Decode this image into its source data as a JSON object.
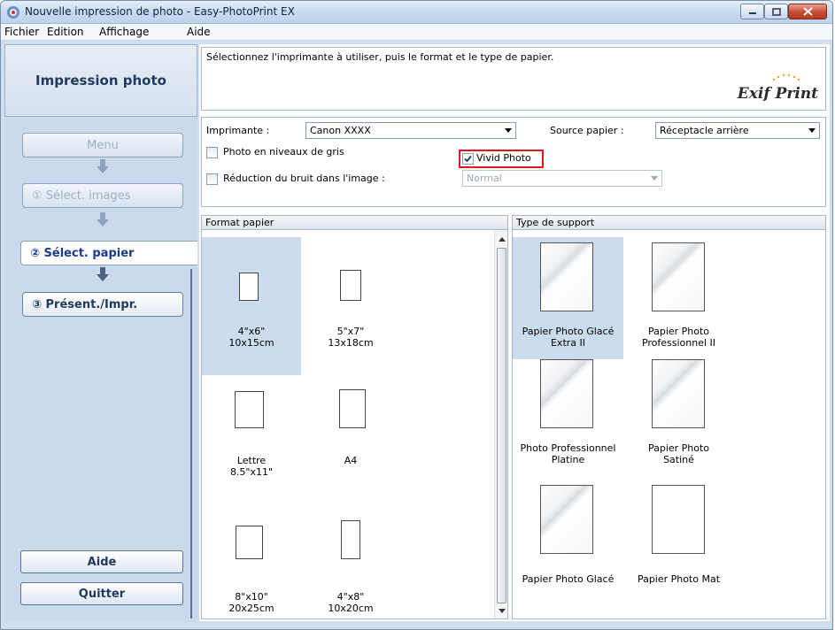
{
  "window": {
    "title": "Nouvelle impression de photo - Easy-PhotoPrint EX"
  },
  "menubar": {
    "items": [
      "Fichier",
      "Edition",
      "Affichage",
      "Aide"
    ]
  },
  "left": {
    "header": "Impression photo",
    "steps": {
      "menu": "Menu",
      "select_images": "① Sélect. images",
      "select_paper": "② Sélect. papier",
      "layout_print": "③ Présent./Impr."
    },
    "help": "Aide",
    "quit": "Quitter"
  },
  "instructions": {
    "text": "Sélectionnez l'imprimante à utiliser, puis le format et le type de papier.",
    "logo": "Exif Print"
  },
  "settings": {
    "printer_label": "Imprimante :",
    "printer_value": "Canon XXXX",
    "paper_source_label": "Source papier :",
    "paper_source_value": "Réceptacle arrière",
    "grayscale_label": "Photo en niveaux de gris",
    "grayscale_checked": false,
    "vivid_label": "Vivid Photo",
    "vivid_checked": true,
    "noise_label": "Réduction du bruit dans l'image :",
    "noise_checked": false,
    "noise_value": "Normal"
  },
  "paper_size": {
    "header": "Format papier",
    "items": [
      {
        "label": "4\"x6\"\n10x15cm",
        "selected": true
      },
      {
        "label": "5\"x7\"\n13x18cm",
        "selected": false
      },
      {
        "label": "Lettre\n8.5\"x11\"",
        "selected": false
      },
      {
        "label": "A4",
        "selected": false
      },
      {
        "label": "8\"x10\"\n20x25cm",
        "selected": false
      },
      {
        "label": "4\"x8\"\n10x20cm",
        "selected": false
      }
    ]
  },
  "media_type": {
    "header": "Type de support",
    "items": [
      {
        "label": "Papier Photo Glacé\nExtra II",
        "selected": true
      },
      {
        "label": "Papier Photo\nProfessionnel II",
        "selected": false
      },
      {
        "label": "Photo Professionnel\nPlatine",
        "selected": false
      },
      {
        "label": "Papier Photo\nSatiné",
        "selected": false
      },
      {
        "label": "Papier Photo Glacé",
        "selected": false
      },
      {
        "label": "Papier Photo Mat",
        "selected": false
      }
    ]
  },
  "colors": {
    "highlight": "#e1171b",
    "selection": "#cbdcef",
    "panel": "#cbd9ec"
  }
}
